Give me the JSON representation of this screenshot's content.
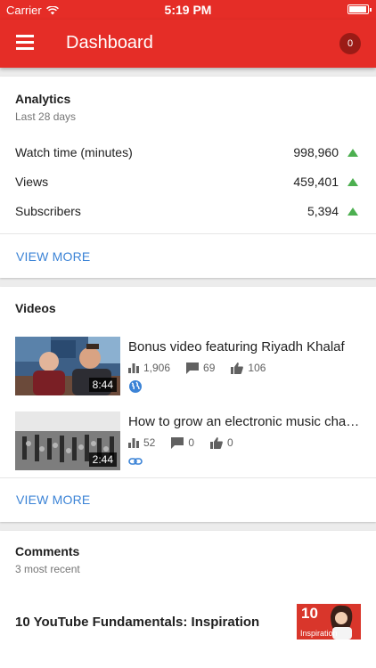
{
  "status_bar": {
    "carrier": "Carrier",
    "time": "5:19 PM"
  },
  "app_bar": {
    "title": "Dashboard",
    "notifications_count": "0"
  },
  "analytics": {
    "title": "Analytics",
    "subtitle": "Last 28 days",
    "metrics": [
      {
        "label": "Watch time (minutes)",
        "value": "998,960",
        "trend": "up"
      },
      {
        "label": "Views",
        "value": "459,401",
        "trend": "up"
      },
      {
        "label": "Subscribers",
        "value": "5,394",
        "trend": "up"
      }
    ],
    "view_more": "VIEW MORE"
  },
  "videos": {
    "title": "Videos",
    "items": [
      {
        "title": "Bonus video featuring Riyadh Khalaf",
        "duration": "8:44",
        "views": "1,906",
        "comments": "69",
        "likes": "106",
        "visibility_icon": "globe-icon"
      },
      {
        "title": "How to grow an electronic music channel",
        "duration": "2:44",
        "views": "52",
        "comments": "0",
        "likes": "0",
        "visibility_icon": "link-icon"
      }
    ],
    "view_more": "VIEW MORE"
  },
  "comments": {
    "title": "Comments",
    "subtitle": "3 most recent",
    "items": [
      {
        "title": "10 YouTube Fundamentals: Inspiration",
        "thumb_number": "10",
        "thumb_label": "Inspiration"
      }
    ]
  },
  "colors": {
    "brand": "#e52d27",
    "badge": "#9b1b16",
    "link": "#3b83d6",
    "trend_up": "#4caf50"
  }
}
